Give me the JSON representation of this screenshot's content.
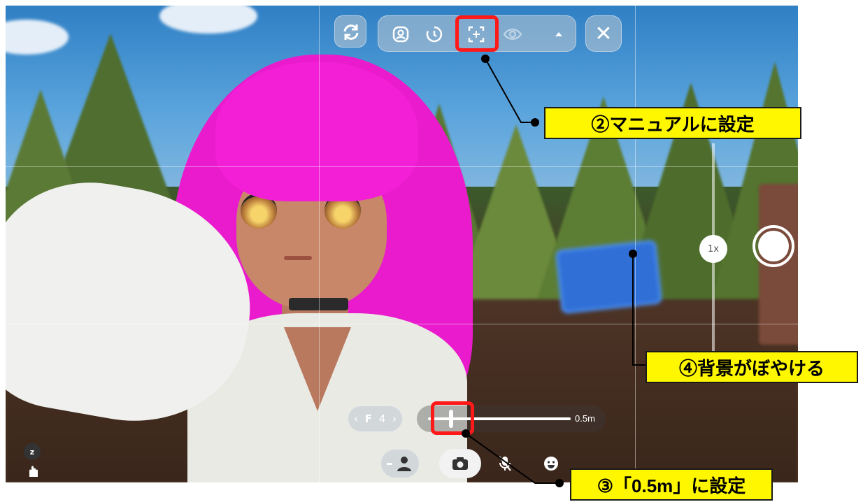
{
  "top_toolbar": {
    "icons": [
      "rotate-icon",
      "portrait-icon",
      "timer-icon",
      "focus-manual-icon",
      "eye-icon",
      "caret-up-icon",
      "close-icon"
    ],
    "close_glyph": "✕"
  },
  "zoom": {
    "label": "1x"
  },
  "focus_controls": {
    "fstop_left": "‹",
    "fstop_label": "F",
    "fstop_value": "4",
    "fstop_right": "›",
    "distance_value": "0.5m",
    "slider_level": 0.16
  },
  "bottom_bar": {
    "icons": [
      "person-icon",
      "camera-icon",
      "mic-off-icon",
      "emoji-icon"
    ]
  },
  "side_badge": {
    "label": "z"
  },
  "annotations": {
    "callout_2": "②マニュアルに設定",
    "callout_3": "③「0.5m」に設定",
    "callout_4": "④背景がぼやける",
    "highlight_color": "#ff1a1a",
    "callout_color": "#fff700"
  }
}
